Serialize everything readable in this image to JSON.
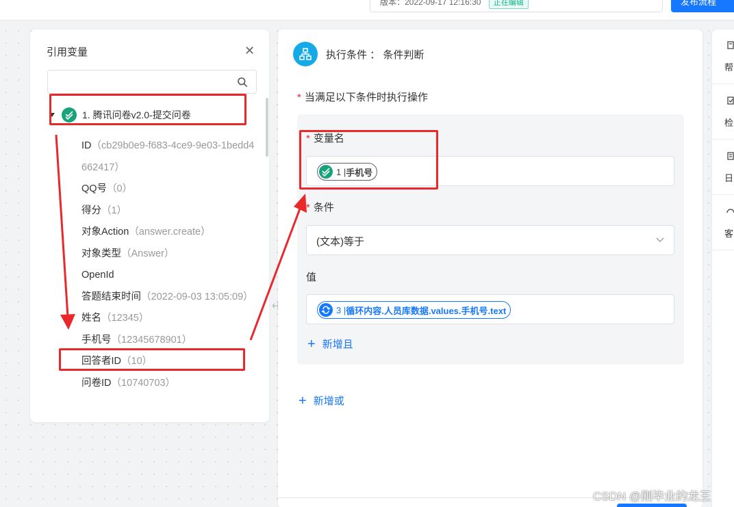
{
  "topbar": {
    "version_text": "版本：2022-09-17 12:16:30",
    "status_tag": "正在编辑",
    "button_label": "发布流程"
  },
  "left_panel": {
    "title": "引用变量",
    "search_placeholder": "",
    "root_label": "1. 腾讯问卷v2.0-提交问卷",
    "items": [
      {
        "name": "ID",
        "value": "（cb29b0e9-f683-4ce9-9e03-1bedd4662417）"
      },
      {
        "name": "QQ号",
        "value": "（0）"
      },
      {
        "name": "得分",
        "value": "（1）"
      },
      {
        "name": "对象Action",
        "value": "（answer.create）"
      },
      {
        "name": "对象类型",
        "value": "（Answer）"
      },
      {
        "name": "OpenId",
        "value": ""
      },
      {
        "name": "答题结束时间",
        "value": "（2022-09-03 13:05:09）"
      },
      {
        "name": "姓名",
        "value": "（12345）"
      },
      {
        "name": "手机号",
        "value": "（12345678901）"
      },
      {
        "name": "回答者ID",
        "value": "（10）"
      },
      {
        "name": "问卷ID",
        "value": "（10740703）"
      }
    ]
  },
  "main_panel": {
    "title": "执行条件 ： 条件判断",
    "requirement_label": "当满足以下条件时执行操作",
    "variable_label": "变量名",
    "variable_chip": {
      "prefix": "1 | ",
      "name": "手机号"
    },
    "condition_label": "条件",
    "condition_value": "(文本)等于",
    "value_label": "值",
    "value_chip": {
      "prefix": "3 | ",
      "name": "循环内容.人员库数据.values.手机号.text"
    },
    "add_and_label": "新增且",
    "add_or_label": "新增或"
  },
  "right_rail": {
    "items": [
      {
        "label": "帮",
        "icon": "help-icon"
      },
      {
        "label": "检",
        "icon": "check-icon"
      },
      {
        "label": "日",
        "icon": "log-icon"
      },
      {
        "label": "客",
        "icon": "support-icon"
      }
    ]
  },
  "watermark": "CSDN @刚毕业的龙王",
  "colors": {
    "primary": "#1677ff",
    "success": "#16a37c",
    "annotation_red": "#e8282b"
  }
}
